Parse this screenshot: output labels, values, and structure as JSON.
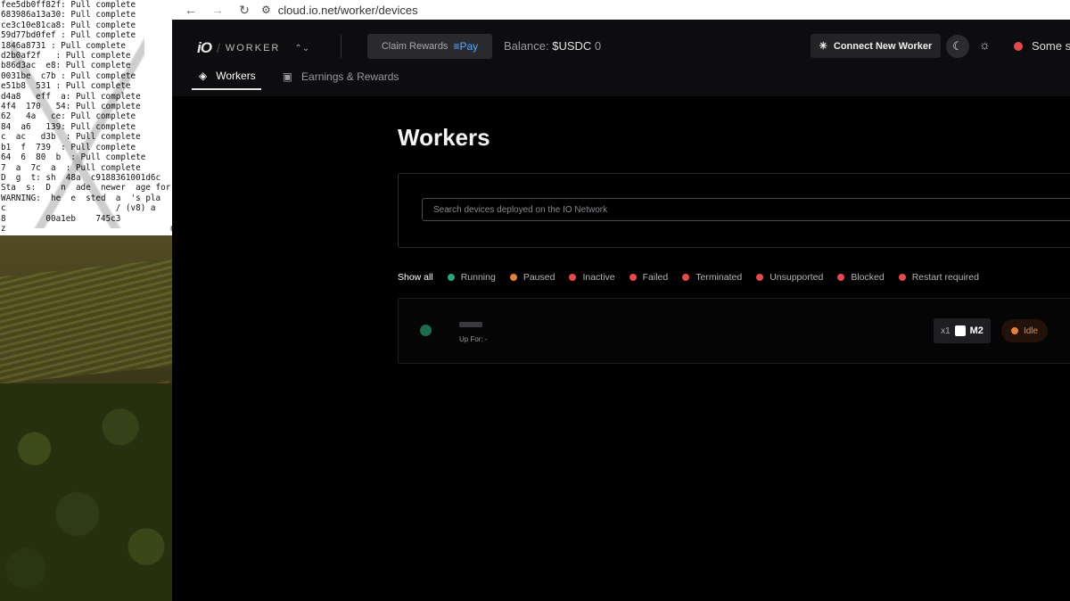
{
  "terminal": {
    "lines": [
      "fee5db0ff82f: Pull complete",
      "683986a13a30: Pull complete",
      "ce3c10e81ca8: Pull complete",
      "59d77bd0fef : Pull complete",
      "1846a8731 : Pull complete",
      "d2b0af2f   : Pull complete",
      "b86d3ac  e8: Pull complete",
      "0031be  c7b : Pull complete",
      "e51b8  531 : Pull complete",
      "d4a8   eff  a: Pull complete",
      "4f4  170   54: Pull complete",
      "62   4a   ce: Pull complete",
      "84  a6   139: Pull complete",
      "c  ac   d3b  : Pull complete",
      "b1  f  739  : Pull complete",
      "64  6  80  b  : Pull complete",
      "7  a  7c  a  : Pull complete",
      "D  g  t: sh  48a  c9188361001d6c",
      "Sta  s:  D  n  ade  newer  age for",
      "WARNING:  he  e  sted  a  's pla",
      "c                      / (v8) a",
      "8        00a1eb    745c3",
      "z                                 min"
    ]
  },
  "browser": {
    "url": "cloud.io.net/worker/devices",
    "back_icon": "←",
    "forward_icon": "→",
    "reload_icon": "↻",
    "tune_icon": "⚙"
  },
  "header": {
    "logo": "iO",
    "separator": "/",
    "product": "WORKER",
    "switch_icon": "⌃⌄",
    "claim_label": "Claim Rewards",
    "pay_label": "≡Pay",
    "balance_label": "Balance:",
    "balance_currency": "$USDC",
    "balance_value": "0",
    "connect_label": "Connect New Worker",
    "connect_icon": "✳",
    "moon_icon": "☾",
    "sun_icon": "☼",
    "status_text": "Some se"
  },
  "tabs": [
    {
      "label": "Workers",
      "icon": "◈",
      "active": true
    },
    {
      "label": "Earnings & Rewards",
      "icon": "▣",
      "active": false
    }
  ],
  "main": {
    "title": "Workers",
    "search_placeholder": "Search devices deployed on the IO Network",
    "filters": [
      {
        "label": "Show all",
        "color": ""
      },
      {
        "label": "Running",
        "color": "#2fa57a"
      },
      {
        "label": "Paused",
        "color": "#e5803a"
      },
      {
        "label": "Inactive",
        "color": "#e5484d"
      },
      {
        "label": "Failed",
        "color": "#e5484d"
      },
      {
        "label": "Terminated",
        "color": "#e5484d"
      },
      {
        "label": "Unsupported",
        "color": "#e5484d"
      },
      {
        "label": "Blocked",
        "color": "#e5484d"
      },
      {
        "label": "Restart required",
        "color": "#e5484d"
      }
    ],
    "device": {
      "up_for": "Up For: -",
      "hw_count": "x1",
      "hw_vendor_icon": "",
      "hw_model": "M2",
      "status": "Idle",
      "status_color": "#e5803a"
    }
  },
  "colors": {
    "accent_running": "#2fa57a",
    "accent_paused": "#e5803a",
    "accent_error": "#e5484d"
  }
}
